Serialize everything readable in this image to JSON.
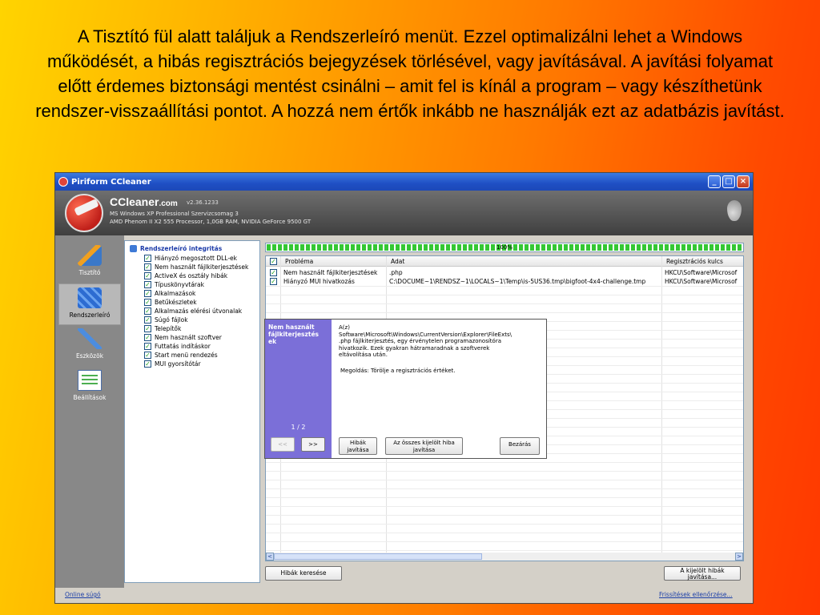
{
  "slide": {
    "text": "A Tisztító fül alatt találjuk a  Rendszerleíró menüt. Ezzel optimalizálni lehet a Windows működését, a hibás regisztrációs bejegyzések törlésével, vagy javításával. A javítási folyamat előtt érdemes biztonsági mentést csinálni – amit fel is kínál a program – vagy készíthetünk rendszer-visszaállítási pontot. A hozzá nem értők inkább ne használják ezt az adatbázis javítást."
  },
  "window": {
    "title": "Piriform CCleaner",
    "controls": {
      "minimize": "_",
      "maximize": "□",
      "close": "×"
    }
  },
  "header": {
    "app_name": "CCleaner",
    "app_domain": ".com",
    "version": "v2.36.1233",
    "sys_line1": "MS Windows XP Professional Szervizcsomag 3",
    "sys_line2": "AMD Phenom II X2 555 Processor, 1,0GB RAM, NVIDIA GeForce 9500 GT"
  },
  "sidebar": {
    "items": [
      {
        "label": "Tisztító",
        "icon": "brush-icon"
      },
      {
        "label": "Rendszerleíró",
        "icon": "cubes-icon"
      },
      {
        "label": "Eszközök",
        "icon": "wrench-icon"
      },
      {
        "label": "Beállítások",
        "icon": "checklist-icon"
      }
    ]
  },
  "checklist": {
    "title": "Rendszerleíró integritás",
    "items": [
      "Hiányzó megosztott DLL-ek",
      "Nem használt fájlkiterjesztések",
      "ActiveX és osztály hibák",
      "Típuskönyvtárak",
      "Alkalmazások",
      "Betűkészletek",
      "Alkalmazás elérési útvonalak",
      "Súgó fájlok",
      "Telepítők",
      "Nem használt szoftver",
      "Futtatás indításkor",
      "Start menü rendezés",
      "MUI gyorsítótár"
    ]
  },
  "progress": {
    "text": "100%",
    "value": 1.0
  },
  "grid": {
    "columns": [
      "Probléma",
      "Adat",
      "Regisztrációs kulcs"
    ],
    "rows": [
      {
        "problem": "Nem használt fájlkiterjesztések",
        "data": ".php",
        "key": "HKCU\\Software\\Microsof"
      },
      {
        "problem": "Hiányzó MUI hivatkozás",
        "data": "C:\\DOCUME~1\\RENDSZ~1\\LOCALS~1\\Temp\\is-5US36.tmp\\bigfoot-4x4-challenge.tmp",
        "key": "HKCU\\Software\\Microsof"
      }
    ]
  },
  "popup": {
    "title": "Nem használt fájlkiterjesztés ek",
    "line1": "A(z)",
    "line2": "Software\\Microsoft\\Windows\\CurrentVersion\\Explorer\\FileExts\\",
    "line3": ".php fájlkiterjesztés, egy érvénytelen programazonosítóra",
    "line4": "hivatkozik. Ezek gyakran hátramaradnak a szoftverek",
    "line5": "eltávolítása után.",
    "fix": "Megoldás: Törölje a regisztrációs értéket.",
    "counter": "1 / 2",
    "prev": "<<",
    "next": ">>",
    "fix_btn_1": "Hibák",
    "fix_btn_2": "javítása",
    "fix_all_1": "Az összes kijelölt hiba",
    "fix_all_2": "javítása",
    "close_btn": "Bezárás"
  },
  "footer": {
    "scan_btn": "Hibák keresése",
    "fix_selected_1": "A kijelölt hibák",
    "fix_selected_2": "javítása...",
    "help_link": "Online súgó",
    "updates_link": "Frissítések ellenőrzése..."
  }
}
